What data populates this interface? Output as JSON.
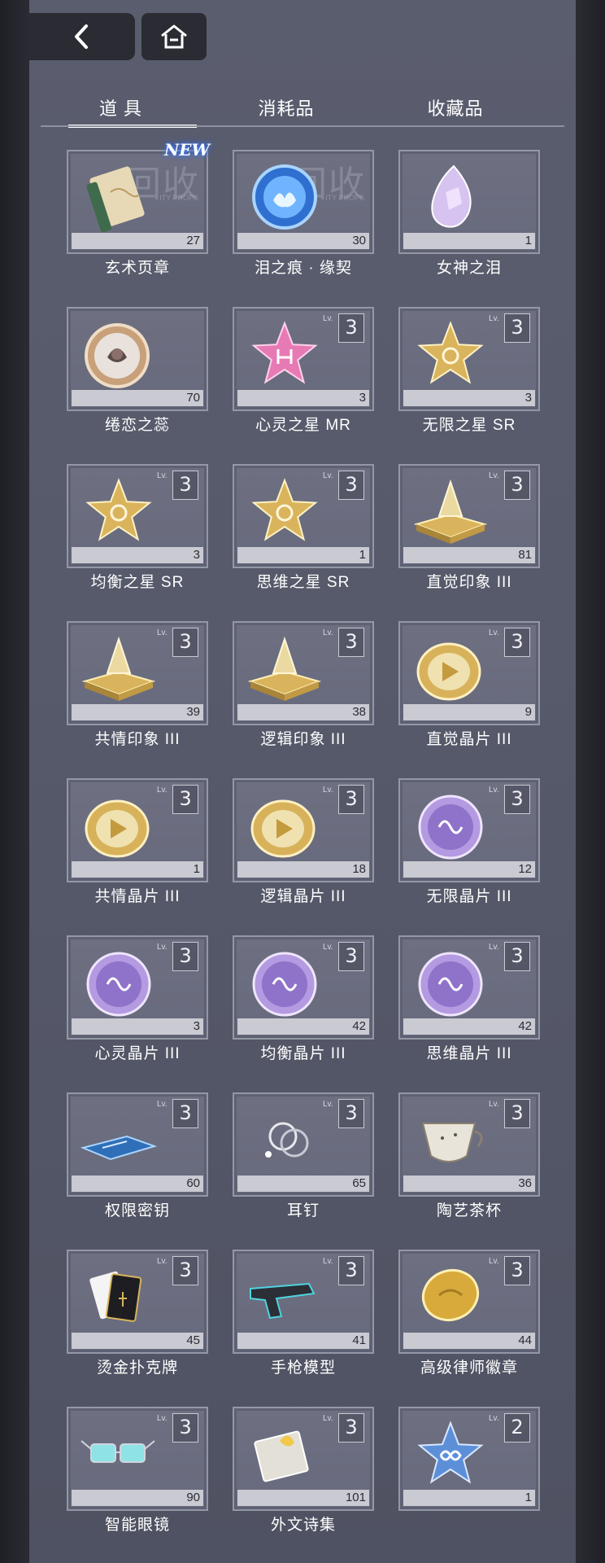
{
  "nav": {
    "back_icon": "chevron-left-icon",
    "home_icon": "home-icon"
  },
  "tabs": [
    {
      "label": "道具",
      "active": true
    },
    {
      "label": "消耗品",
      "active": false
    },
    {
      "label": "收藏品",
      "active": false
    }
  ],
  "badges": {
    "new": "NEW",
    "watermark": "回收",
    "watermark_sub": "ITY PROPS",
    "lv_label": "Lv."
  },
  "items": [
    {
      "name": "玄术页章",
      "count": "27",
      "level": "",
      "icon": "book-icon",
      "new": true,
      "watermark": true
    },
    {
      "name": "泪之痕 · 缘契",
      "count": "30",
      "level": "",
      "icon": "blue-medal-icon",
      "watermark": true
    },
    {
      "name": "女神之泪",
      "count": "1",
      "level": "",
      "icon": "crystal-tear-icon"
    },
    {
      "name": "绻恋之蕊",
      "count": "70",
      "level": "",
      "icon": "rose-coin-icon"
    },
    {
      "name": "心灵之星 MR",
      "count": "3",
      "level": "3",
      "icon": "pink-star-icon"
    },
    {
      "name": "无限之星 SR",
      "count": "3",
      "level": "3",
      "icon": "gold-star-icon"
    },
    {
      "name": "均衡之星 SR",
      "count": "3",
      "level": "3",
      "icon": "gold-star-icon"
    },
    {
      "name": "思维之星 SR",
      "count": "1",
      "level": "3",
      "icon": "gold-star-icon"
    },
    {
      "name": "直觉印象 III",
      "count": "81",
      "level": "3",
      "icon": "gold-plate-icon"
    },
    {
      "name": "共情印象 III",
      "count": "39",
      "level": "3",
      "icon": "gold-plate-icon"
    },
    {
      "name": "逻辑印象 III",
      "count": "38",
      "level": "3",
      "icon": "gold-plate-icon"
    },
    {
      "name": "直觉晶片 III",
      "count": "9",
      "level": "3",
      "icon": "gold-chip-icon"
    },
    {
      "name": "共情晶片 III",
      "count": "1",
      "level": "3",
      "icon": "gold-chip-icon"
    },
    {
      "name": "逻辑晶片 III",
      "count": "18",
      "level": "3",
      "icon": "gold-chip-icon"
    },
    {
      "name": "无限晶片 III",
      "count": "12",
      "level": "3",
      "icon": "purple-chip-icon"
    },
    {
      "name": "心灵晶片 III",
      "count": "3",
      "level": "3",
      "icon": "purple-chip-icon"
    },
    {
      "name": "均衡晶片 III",
      "count": "42",
      "level": "3",
      "icon": "purple-chip-icon"
    },
    {
      "name": "思维晶片 III",
      "count": "42",
      "level": "3",
      "icon": "purple-chip-icon"
    },
    {
      "name": "权限密钥",
      "count": "60",
      "level": "3",
      "icon": "keycard-icon"
    },
    {
      "name": "耳钉",
      "count": "65",
      "level": "3",
      "icon": "earring-icon"
    },
    {
      "name": "陶艺茶杯",
      "count": "36",
      "level": "3",
      "icon": "teacup-icon"
    },
    {
      "name": "烫金扑克牌",
      "count": "45",
      "level": "3",
      "icon": "cards-icon"
    },
    {
      "name": "手枪模型",
      "count": "41",
      "level": "3",
      "icon": "pistol-icon"
    },
    {
      "name": "高级律师徽章",
      "count": "44",
      "level": "3",
      "icon": "gold-badge-icon"
    },
    {
      "name": "智能眼镜",
      "count": "90",
      "level": "3",
      "icon": "glasses-icon"
    },
    {
      "name": "外文诗集",
      "count": "101",
      "level": "3",
      "icon": "poetry-book-icon"
    },
    {
      "name": "",
      "count": "1",
      "level": "2",
      "icon": "blue-star-icon"
    }
  ],
  "colors": {
    "panel": "#585b6b",
    "gold": "#d8b25a",
    "purple": "#b49ae0",
    "blue": "#4f8fe0"
  }
}
